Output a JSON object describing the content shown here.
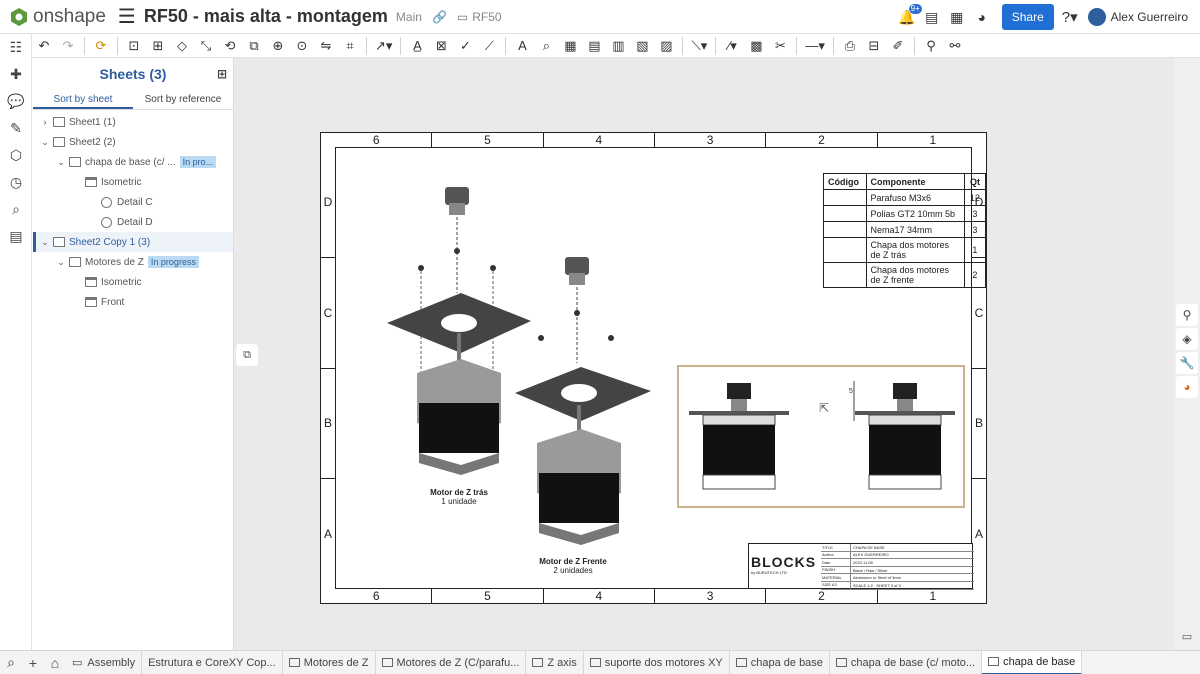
{
  "app": {
    "brand": "onshape",
    "doc_title": "RF50 - mais alta - montagem",
    "branch": "Main",
    "folder": "RF50",
    "notification_count": "9+",
    "share_label": "Share",
    "user_name": "Alex Guerreiro"
  },
  "panel": {
    "title": "Sheets (3)",
    "tabs": [
      "Sort by sheet",
      "Sort by reference"
    ],
    "tree": [
      {
        "label": "Sheet1 (1)",
        "level": 0,
        "chevron": "right"
      },
      {
        "label": "Sheet2 (2)",
        "level": 0,
        "chevron": "down"
      },
      {
        "label": "chapa de base (c/ ...",
        "level": 1,
        "chevron": "down",
        "tag": "In pro..."
      },
      {
        "label": "Isometric",
        "level": 2
      },
      {
        "label": "Detail C",
        "level": 3
      },
      {
        "label": "Detail D",
        "level": 3
      },
      {
        "label": "Sheet2 Copy 1 (3)",
        "level": 0,
        "chevron": "down",
        "selected": true
      },
      {
        "label": "Motores de Z",
        "level": 1,
        "chevron": "down",
        "tag": "In progress"
      },
      {
        "label": "Isometric",
        "level": 2
      },
      {
        "label": "Front",
        "level": 2
      }
    ]
  },
  "drawing": {
    "zones_h": [
      "6",
      "5",
      "4",
      "3",
      "2",
      "1"
    ],
    "zones_v": [
      "D",
      "C",
      "B",
      "A"
    ],
    "bom": {
      "headers": [
        "Código",
        "Componente",
        "Qt"
      ],
      "rows": [
        [
          "",
          "Parafuso M3x6",
          "12"
        ],
        [
          "",
          "Polias GT2 10mm 5b",
          "3"
        ],
        [
          "",
          "Nema17 34mm",
          "3"
        ],
        [
          "",
          "Chapa dos motores de Z trás",
          "1"
        ],
        [
          "",
          "Chapa dos motores de Z frente",
          "2"
        ]
      ]
    },
    "label_rear_title": "Motor de Z trás",
    "label_rear_sub": "1 unidade",
    "label_front_title": "Motor de Z Frente",
    "label_front_sub": "2 unidades",
    "detail_dim": "5",
    "title_block": {
      "brand": "BLOCKS",
      "brand_sub": "by BURUTECH LTD",
      "rows": [
        [
          "TITLE",
          "CHAPA DE BASE"
        ],
        [
          "Author",
          "ALEX GUERREIRO"
        ],
        [
          "Date",
          "2023.11.08"
        ],
        [
          "FINISH",
          "Black / Raw / Silver"
        ],
        [
          "MATERIAL",
          "Aluminium or Steel of 3mm"
        ],
        [
          "SIZE A3",
          "SCALE 1:2 · SHEET 3 of 3"
        ]
      ]
    }
  },
  "bottom_tabs": [
    {
      "label": "Assembly",
      "icon": "folder"
    },
    {
      "label": "Estrutura e CoreXY Cop...",
      "icon": "none"
    },
    {
      "label": "Motores de Z",
      "icon": "doc"
    },
    {
      "label": "Motores de Z (C/parafu...",
      "icon": "doc"
    },
    {
      "label": "Z axis",
      "icon": "doc"
    },
    {
      "label": "suporte dos motores XY",
      "icon": "doc"
    },
    {
      "label": "chapa de base",
      "icon": "doc"
    },
    {
      "label": "chapa de base (c/ moto...",
      "icon": "doc"
    },
    {
      "label": "chapa de base",
      "icon": "doc",
      "active": true
    }
  ],
  "colors": {
    "accent": "#2f5e9e",
    "share": "#1f6fd4",
    "tag_bg": "#b9daf2",
    "canvas": "#eaeaea",
    "detail_frame": "#c9b38c"
  }
}
